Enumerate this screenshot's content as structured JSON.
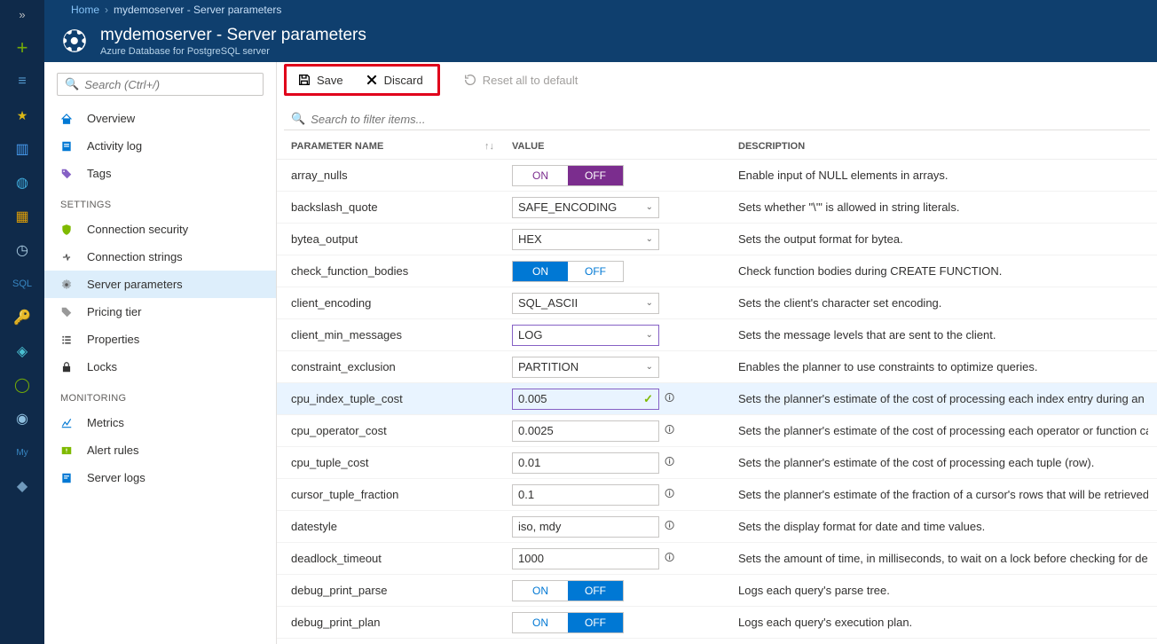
{
  "breadcrumb": {
    "home": "Home",
    "current": "mydemoserver - Server parameters"
  },
  "header": {
    "title": "mydemoserver - Server parameters",
    "subtitle": "Azure Database for PostgreSQL server"
  },
  "sidebar": {
    "search_placeholder": "Search (Ctrl+/)",
    "top": [
      {
        "icon": "overview",
        "label": "Overview"
      },
      {
        "icon": "log",
        "label": "Activity log"
      },
      {
        "icon": "tag",
        "label": "Tags"
      }
    ],
    "settings_label": "SETTINGS",
    "settings": [
      {
        "icon": "shield",
        "label": "Connection security"
      },
      {
        "icon": "conn",
        "label": "Connection strings"
      },
      {
        "icon": "gear",
        "label": "Server parameters",
        "active": true
      },
      {
        "icon": "price",
        "label": "Pricing tier"
      },
      {
        "icon": "props",
        "label": "Properties"
      },
      {
        "icon": "lock",
        "label": "Locks"
      }
    ],
    "monitoring_label": "MONITORING",
    "monitoring": [
      {
        "icon": "metrics",
        "label": "Metrics"
      },
      {
        "icon": "alert",
        "label": "Alert rules"
      },
      {
        "icon": "logs",
        "label": "Server logs"
      }
    ]
  },
  "toolbar": {
    "save": "Save",
    "discard": "Discard",
    "reset": "Reset all to default"
  },
  "filter_placeholder": "Search to filter items...",
  "cols": {
    "name": "PARAMETER NAME",
    "value": "VALUE",
    "desc": "DESCRIPTION",
    "sort": "↑↓"
  },
  "onoff": {
    "on": "ON",
    "off": "OFF"
  },
  "rows": [
    {
      "name": "array_nulls",
      "type": "toggle",
      "style": "purple",
      "on": false,
      "desc": "Enable input of NULL elements in arrays."
    },
    {
      "name": "backslash_quote",
      "type": "dropdown",
      "value": "SAFE_ENCODING",
      "desc": "Sets whether \"\\'\" is allowed in string literals."
    },
    {
      "name": "bytea_output",
      "type": "dropdown",
      "value": "HEX",
      "desc": "Sets the output format for bytea."
    },
    {
      "name": "check_function_bodies",
      "type": "toggle",
      "style": "blue",
      "on": true,
      "desc": "Check function bodies during CREATE FUNCTION."
    },
    {
      "name": "client_encoding",
      "type": "dropdown",
      "value": "SQL_ASCII",
      "desc": "Sets the client's character set encoding."
    },
    {
      "name": "client_min_messages",
      "type": "dropdown",
      "value": "LOG",
      "purple": true,
      "desc": "Sets the message levels that are sent to the client."
    },
    {
      "name": "constraint_exclusion",
      "type": "dropdown",
      "value": "PARTITION",
      "desc": "Enables the planner to use constraints to optimize queries."
    },
    {
      "name": "cpu_index_tuple_cost",
      "type": "text",
      "value": "0.005",
      "purple": true,
      "check": true,
      "info": true,
      "selected": true,
      "desc": "Sets the planner's estimate of the cost of processing each index entry during an in"
    },
    {
      "name": "cpu_operator_cost",
      "type": "text",
      "value": "0.0025",
      "info": true,
      "desc": "Sets the planner's estimate of the cost of processing each operator or function cal"
    },
    {
      "name": "cpu_tuple_cost",
      "type": "text",
      "value": "0.01",
      "info": true,
      "desc": "Sets the planner's estimate of the cost of processing each tuple (row)."
    },
    {
      "name": "cursor_tuple_fraction",
      "type": "text",
      "value": "0.1",
      "info": true,
      "desc": "Sets the planner's estimate of the fraction of a cursor's rows that will be retrieved."
    },
    {
      "name": "datestyle",
      "type": "text",
      "value": "iso, mdy",
      "info": true,
      "desc": "Sets the display format for date and time values."
    },
    {
      "name": "deadlock_timeout",
      "type": "text",
      "value": "1000",
      "info": true,
      "desc": "Sets the amount of time, in milliseconds, to wait on a lock before checking for dea"
    },
    {
      "name": "debug_print_parse",
      "type": "toggle",
      "style": "blue",
      "on": false,
      "desc": "Logs each query's parse tree."
    },
    {
      "name": "debug_print_plan",
      "type": "toggle",
      "style": "blue",
      "on": false,
      "desc": "Logs each query's execution plan."
    }
  ]
}
